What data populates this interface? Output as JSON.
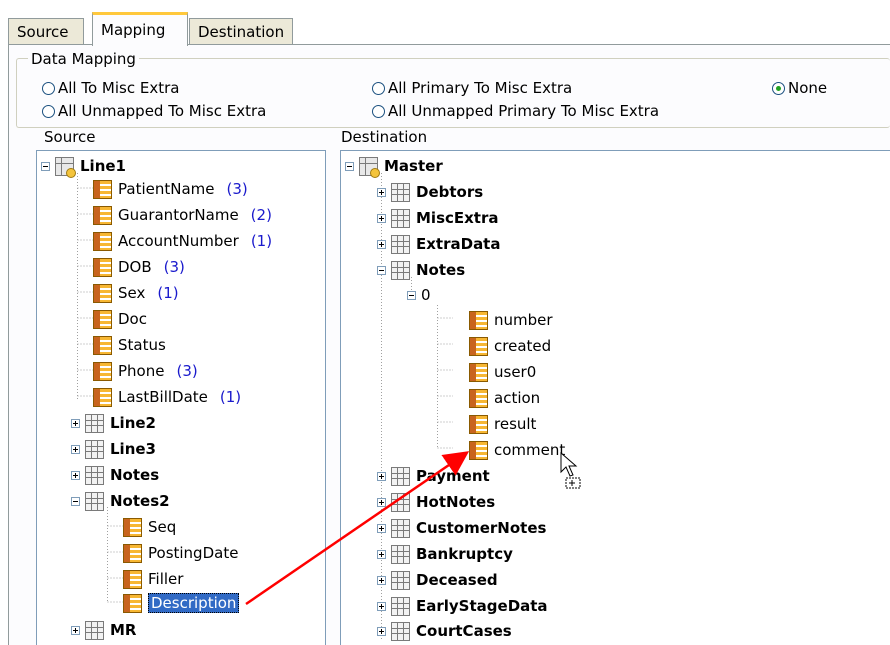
{
  "tabs": [
    "Source",
    "Mapping",
    "Destination"
  ],
  "data_mapping": {
    "title": "Data Mapping",
    "options": [
      "All To Misc Extra",
      "All Unmapped To Misc Extra",
      "All Primary To Misc Extra",
      "All Unmapped Primary To Misc Extra",
      "None"
    ],
    "selected": "None"
  },
  "source_label": "Source",
  "destination_label": "Destination",
  "source_tree": {
    "root": "Line1",
    "line1_fields": [
      {
        "name": "PatientName",
        "count": "(3)"
      },
      {
        "name": "GuarantorName",
        "count": "(2)"
      },
      {
        "name": "AccountNumber",
        "count": "(1)"
      },
      {
        "name": "DOB",
        "count": "(3)"
      },
      {
        "name": "Sex",
        "count": "(1)"
      },
      {
        "name": "Doc",
        "count": ""
      },
      {
        "name": "Status",
        "count": ""
      },
      {
        "name": "Phone",
        "count": "(3)"
      },
      {
        "name": "LastBillDate",
        "count": "(1)"
      }
    ],
    "groups": [
      "Line2",
      "Line3",
      "Notes",
      "Notes2"
    ],
    "notes2_fields": [
      "Seq",
      "PostingDate",
      "Filler",
      "Description"
    ],
    "trailing_group": "MR"
  },
  "destination_tree": {
    "root": "Master",
    "groups_before": [
      "Debtors",
      "MiscExtra",
      "ExtraData",
      "Notes"
    ],
    "notes_index": "0",
    "notes_fields": [
      "number",
      "created",
      "user0",
      "action",
      "result",
      "comment"
    ],
    "groups_after": [
      "Payment",
      "HotNotes",
      "CustomerNotes",
      "Bankruptcy",
      "Deceased",
      "EarlyStageData",
      "CourtCases"
    ]
  },
  "colors": {
    "arrow": "#ff0000",
    "selection": "#316ac5",
    "count": "#1a1acc"
  }
}
